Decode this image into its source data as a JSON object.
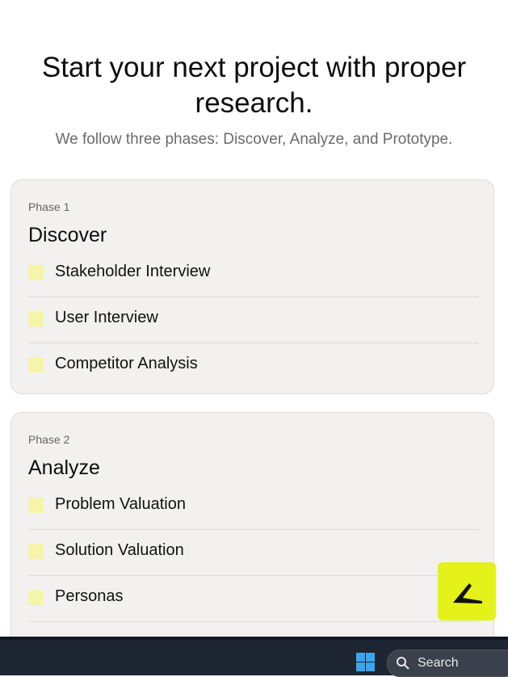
{
  "hero": {
    "title": "Start your next project with proper research.",
    "subtitle": "We follow three phases: Discover, Analyze, and Prototype."
  },
  "phases": [
    {
      "label": "Phase 1",
      "title": "Discover",
      "items": [
        "Stakeholder Interview",
        "User Interview",
        "Competitor Analysis"
      ]
    },
    {
      "label": "Phase 2",
      "title": "Analyze",
      "items": [
        "Problem Valuation",
        "Solution Valuation",
        "Personas"
      ]
    }
  ],
  "fab": {
    "icon": "brand-logo-icon",
    "color": "#e4f21a"
  },
  "taskbar": {
    "start_icon": "windows-icon",
    "search_label": "Search",
    "search_icon": "search-icon"
  }
}
